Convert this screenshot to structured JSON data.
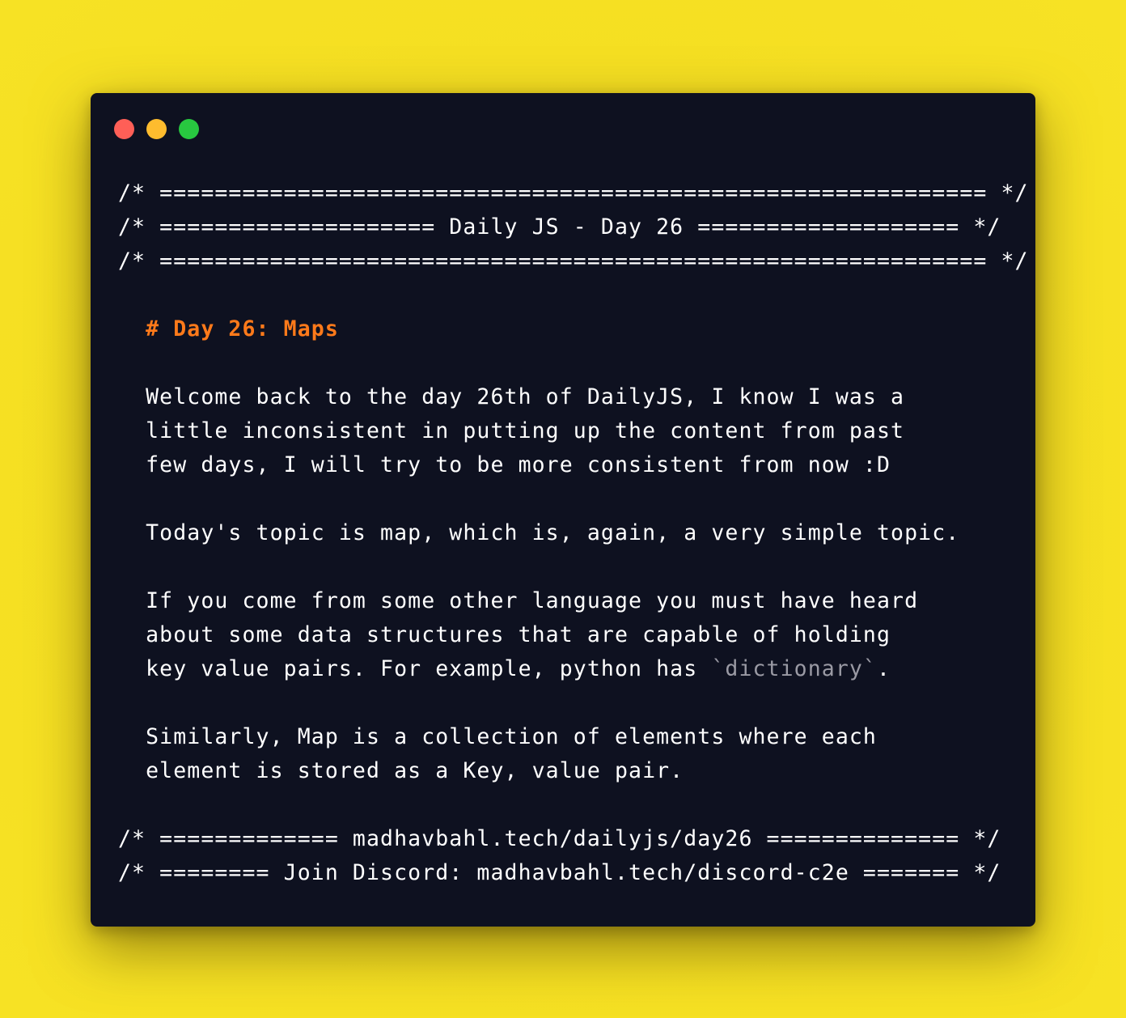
{
  "window": {
    "controls": {
      "close_color": "#ff5f57",
      "minimize_color": "#febc2e",
      "maximize_color": "#28c840"
    }
  },
  "code": {
    "header_lines": [
      "/* ============================================================ */",
      "/* ==================== Daily JS - Day 26 =================== */",
      "/* ============================================================ */"
    ],
    "heading": "# Day 26: Maps",
    "paragraph1": [
      "Welcome back to the day 26th of DailyJS, I know I was a",
      "little inconsistent in putting up the content from past",
      "few days, I will try to be more consistent from now :D"
    ],
    "paragraph2": [
      "Today's topic is map, which is, again, a very simple topic."
    ],
    "paragraph3": [
      "If you come from some other language you must have heard",
      "about some data structures that are capable of holding"
    ],
    "paragraph3_last": {
      "before": "key value pairs. For example, python has ",
      "code": "`dictionary`",
      "after": "."
    },
    "paragraph4": [
      "Similarly, Map is a collection of elements where each",
      "element is stored as a Key, value pair."
    ],
    "footer_lines": [
      "/* ============= madhavbahl.tech/dailyjs/day26 ============== */",
      "/* ======== Join Discord: madhavbahl.tech/discord-c2e ======= */"
    ],
    "colors": {
      "background": "#0e1120",
      "text": "#ffffff",
      "heading": "#ff7a1a",
      "inline_code": "#9a9aa4",
      "page_background": "#f5df22"
    }
  }
}
